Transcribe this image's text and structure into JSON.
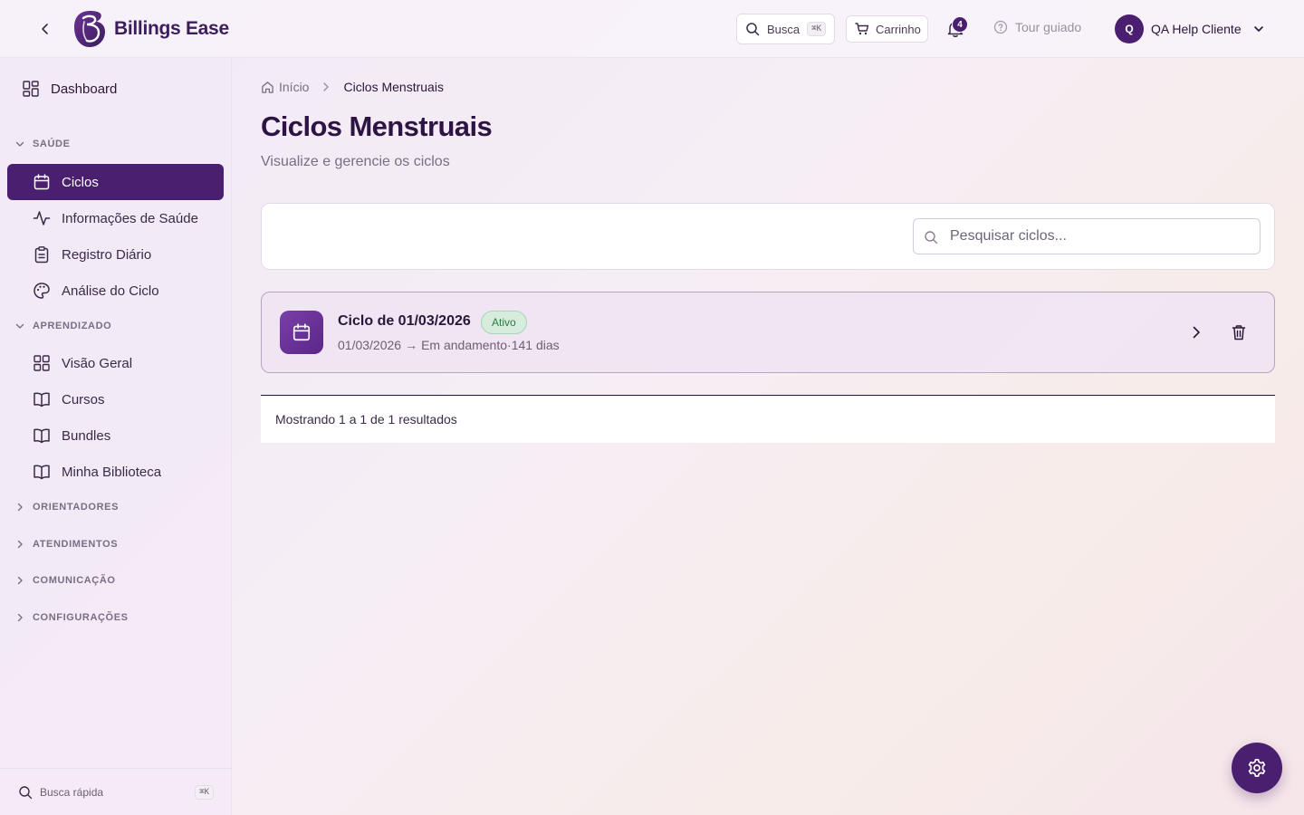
{
  "header": {
    "brand": "Billings Ease",
    "search_label": "Busca",
    "search_shortcut": "⌘K",
    "cart_label": "Carrinho",
    "notifications_count": "4",
    "tour_label": "Tour guiado",
    "user_initial": "Q",
    "user_name": "QA Help Cliente"
  },
  "sidebar": {
    "dashboard_label": "Dashboard",
    "sections": {
      "saude": {
        "label": "SAÚDE",
        "items": [
          "Ciclos",
          "Informações de Saúde",
          "Registro Diário",
          "Análise do Ciclo"
        ]
      },
      "aprendizado": {
        "label": "APRENDIZADO",
        "items": [
          "Visão Geral",
          "Cursos",
          "Bundles",
          "Minha Biblioteca"
        ]
      },
      "orientadores": {
        "label": "ORIENTADORES"
      },
      "atendimentos": {
        "label": "ATENDIMENTOS"
      },
      "comunicacao": {
        "label": "COMUNICAÇÃO"
      },
      "configuracoes": {
        "label": "CONFIGURAÇÕES"
      }
    },
    "active_item": "Ciclos",
    "quick_search_label": "Busca rápida",
    "quick_search_shortcut": "⌘K"
  },
  "main": {
    "breadcrumb": {
      "home": "Início",
      "current": "Ciclos Menstruais"
    },
    "title": "Ciclos Menstruais",
    "subtitle": "Visualize e gerencie os ciclos",
    "search_placeholder": "Pesquisar ciclos...",
    "cycles": [
      {
        "title": "Ciclo de 01/03/2026",
        "status": "Ativo",
        "start": "01/03/2026",
        "arrow": "→",
        "end": "Em andamento",
        "separator": "·",
        "duration": "141 dias"
      }
    ],
    "results_text": "Mostrando 1 a 1 de 1 resultados"
  },
  "colors": {
    "brand": "#4b1f6f",
    "badge_bg": "#d6ecdc",
    "badge_text": "#2e7a45"
  }
}
